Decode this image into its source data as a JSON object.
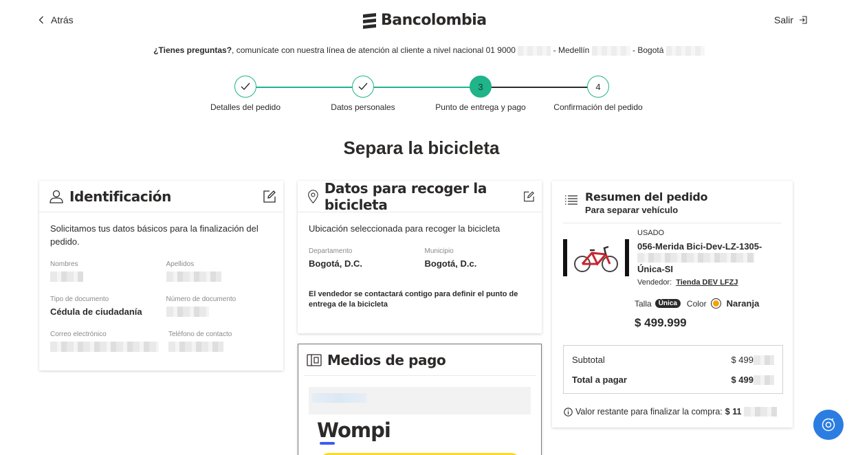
{
  "header": {
    "back_label": "Atrás",
    "logo_text": "Bancolombia",
    "logout_label": "Salir"
  },
  "help": {
    "question": "¿Tienes preguntas?",
    "text": ", comunícate con nuestra línea de atención al cliente a nivel nacional 01 9000",
    "medellin": "- Medellín",
    "bogota": "- Bogotá"
  },
  "stepper": {
    "steps": [
      {
        "label": "Detalles del pedido",
        "state": "done"
      },
      {
        "label": "Datos personales",
        "state": "done"
      },
      {
        "label": "Punto de entrega y pago",
        "state": "current",
        "number": "3"
      },
      {
        "label": "Confirmación del pedido",
        "state": "pending",
        "number": "4"
      }
    ],
    "accent": "#1fb48a"
  },
  "page_title": "Separa la bicicleta",
  "identification": {
    "title": "Identificación",
    "intro": "Solicitamos tus datos básicos para la finalización del pedido.",
    "fields": {
      "nombres_label": "Nombres",
      "apellidos_label": "Apellidos",
      "tipo_doc_label": "Tipo de documento",
      "tipo_doc_value": "Cédula de ciudadanía",
      "num_doc_label": "Número de documento",
      "correo_label": "Correo electrónico",
      "telefono_label": "Teléfono de contacto"
    }
  },
  "pickup": {
    "title": "Datos para recoger la bicicleta",
    "intro": "Ubicación seleccionada para recoger la bicicleta",
    "departamento_label": "Departamento",
    "departamento_value": "Bogotá, D.C.",
    "municipio_label": "Municipio",
    "municipio_value": "Bogotá, D.c.",
    "note": "El vendedor se contactará contigo para definir el punto de entrega de la bicicleta"
  },
  "payment": {
    "title": "Medios de pago",
    "provider": "Wompi"
  },
  "summary": {
    "title": "Resumen del pedido",
    "subtitle": "Para separar vehículo",
    "condition": "USADO",
    "product_name_1": "056-Merida Bici-Dev-LZ-1305-",
    "product_name_2": "Única-SI",
    "vendor_label": "Vendedor:",
    "vendor_name": "Tienda DEV LFZJ",
    "talla_label": "Talla",
    "talla_value": "Única",
    "color_label": "Color",
    "color_value": "Naranja",
    "color_swatch": "#f4a300",
    "price": "$ 499.999",
    "subtotal_label": "Subtotal",
    "subtotal_value": "$ 499",
    "total_label": "Total a pagar",
    "total_value": "$ 499",
    "remaining_label": "Valor restante para finalizar la compra:",
    "remaining_value": "$ 11"
  }
}
